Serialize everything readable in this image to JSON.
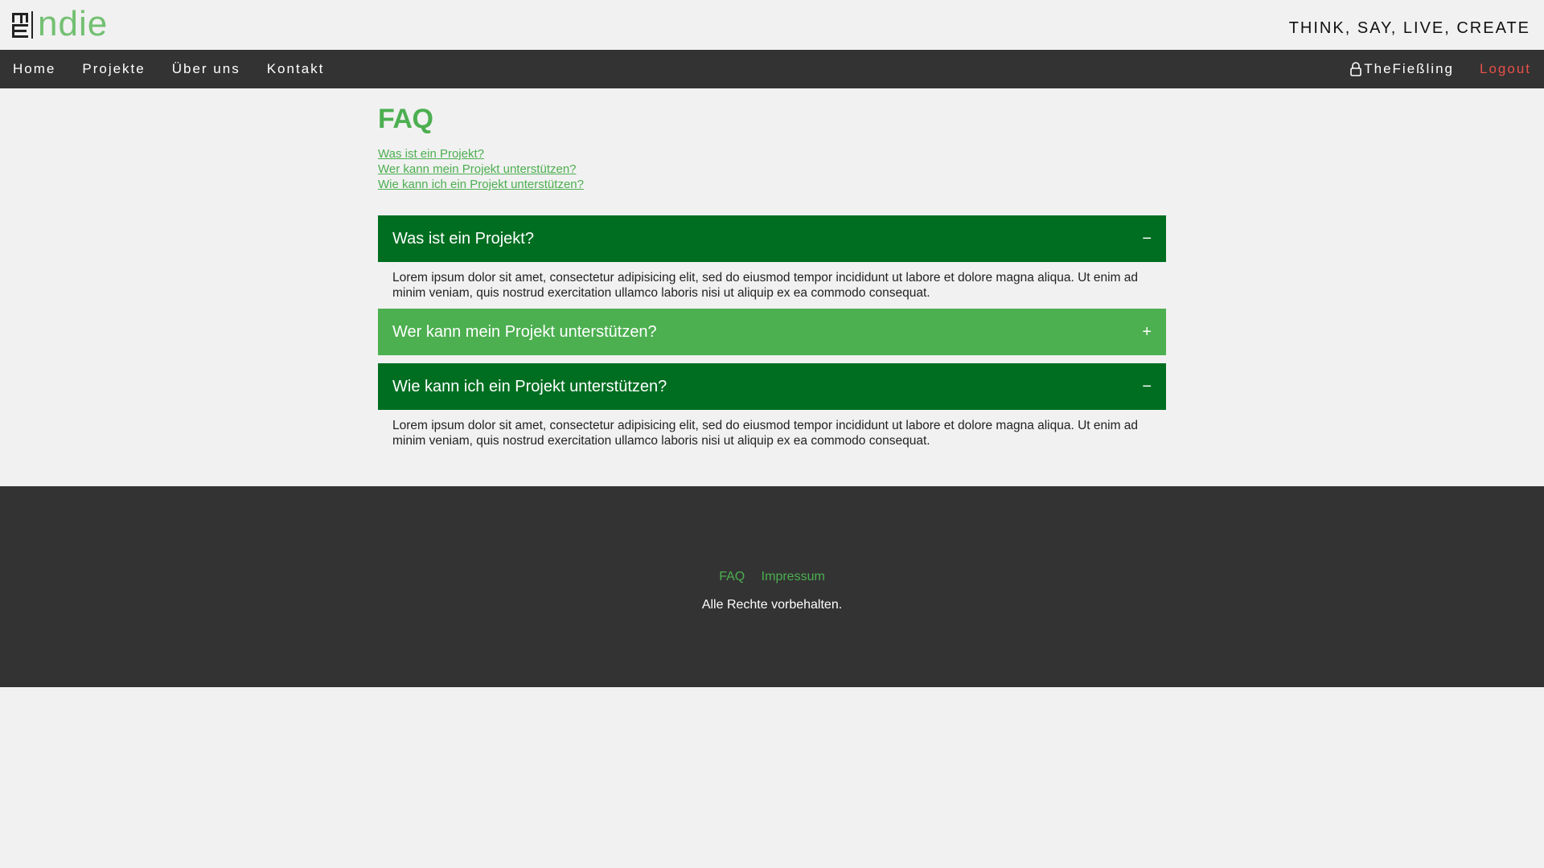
{
  "header": {
    "logo_text": "ndie",
    "tagline": "THINK, SAY, LIVE, CREATE"
  },
  "nav": {
    "items": [
      "Home",
      "Projekte",
      "Über uns",
      "Kontakt"
    ],
    "user_icon": "user-icon",
    "username": "TheFießling",
    "logout": "Logout"
  },
  "main": {
    "title": "FAQ",
    "toc": [
      "Was ist ein Projekt?",
      "Wer kann mein Projekt unterstützen?",
      "Wie kann ich ein Projekt unterstützen?"
    ],
    "faqs": [
      {
        "question": "Was ist ein Projekt?",
        "sign": "−",
        "answer": "Lorem ipsum dolor sit amet, consectetur adipisicing elit, sed do eiusmod tempor incididunt ut labore et dolore magna aliqua. Ut enim ad minim veniam, quis nostrud exercitation ullamco laboris nisi ut aliquip ex ea commodo consequat."
      },
      {
        "question": "Wer kann mein Projekt unterstützen?",
        "sign": "+"
      },
      {
        "question": "Wie kann ich ein Projekt unterstützen?",
        "sign": "−",
        "answer": "Lorem ipsum dolor sit amet, consectetur adipisicing elit, sed do eiusmod tempor incididunt ut labore et dolore magna aliqua. Ut enim ad minim veniam, quis nostrud exercitation ullamco laboris nisi ut aliquip ex ea commodo consequat."
      }
    ]
  },
  "footer": {
    "links": [
      "FAQ",
      "Impressum"
    ],
    "copyright": "Alle Rechte vorbehalten."
  },
  "colors": {
    "accent_green": "#4caf50",
    "dark_green": "#006e21",
    "dark_bar": "#333333",
    "logout_red": "#e8504a"
  }
}
